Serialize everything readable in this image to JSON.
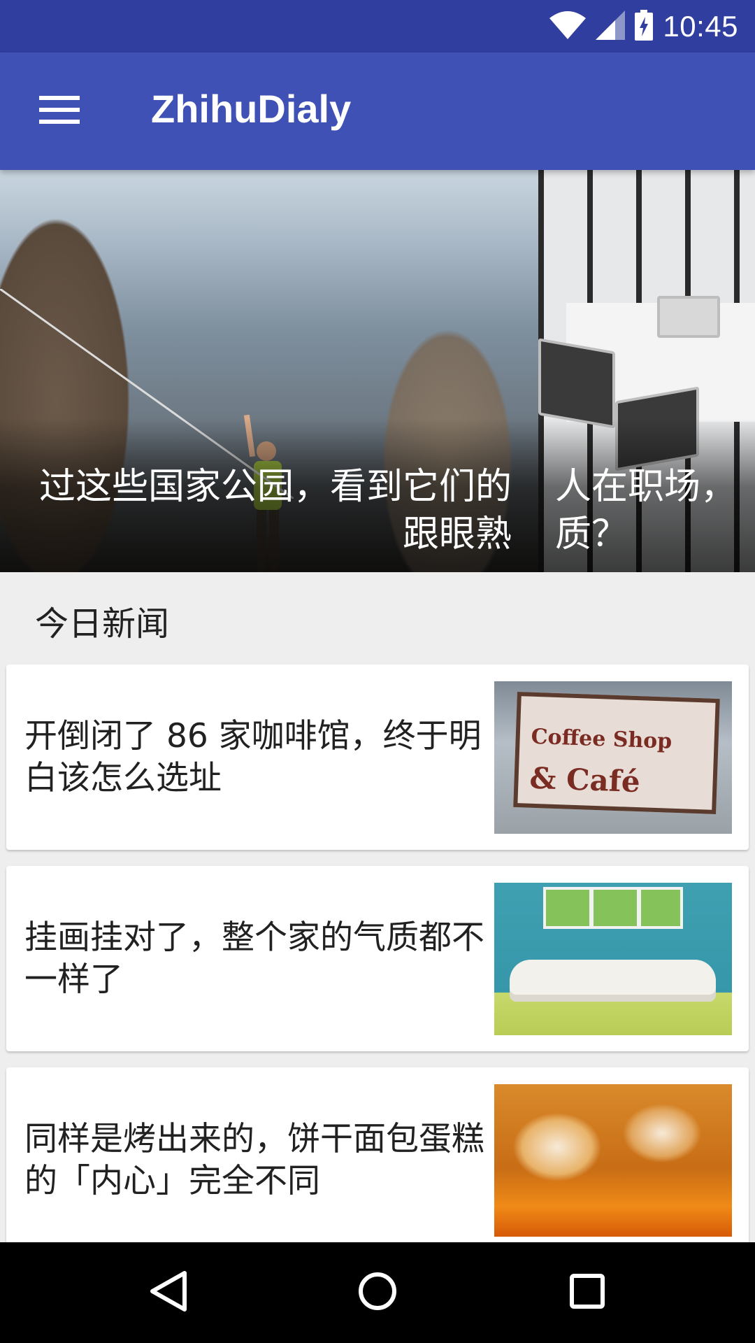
{
  "status_bar": {
    "time": "10:45",
    "icons": [
      "wifi-icon",
      "cell-signal-icon",
      "battery-charging-icon"
    ]
  },
  "app_bar": {
    "title": "ZhihuDialy",
    "menu_icon": "hamburger-menu-icon"
  },
  "banner": {
    "slides": [
      {
        "title": "过这些国家公园，看到它们的\n跟眼熟",
        "image": "national-park-cliff-photo"
      },
      {
        "title": "人在职场，\n质？",
        "image": "office-laptops-photo"
      }
    ]
  },
  "section": {
    "title": "今日新闻"
  },
  "news": [
    {
      "title": "开倒闭了 86 家咖啡馆，终于明白该怎么选址",
      "image": "coffee-shop-sign-photo",
      "image_text_1": "Coffee Shop",
      "image_text_2": "& Café"
    },
    {
      "title": "挂画挂对了，整个家的气质都不一样了",
      "image": "sofa-wall-art-photo"
    },
    {
      "title": "同样是烤出来的，饼干面包蛋糕的「内心」完全不同",
      "image": "baked-buns-photo"
    }
  ],
  "nav_bar": {
    "icons": [
      "back-icon",
      "home-icon",
      "recents-icon"
    ]
  },
  "colors": {
    "status_bar": "#303f9f",
    "app_bar": "#3f51b5",
    "background": "#eeeeee",
    "nav_bar": "#000000"
  }
}
